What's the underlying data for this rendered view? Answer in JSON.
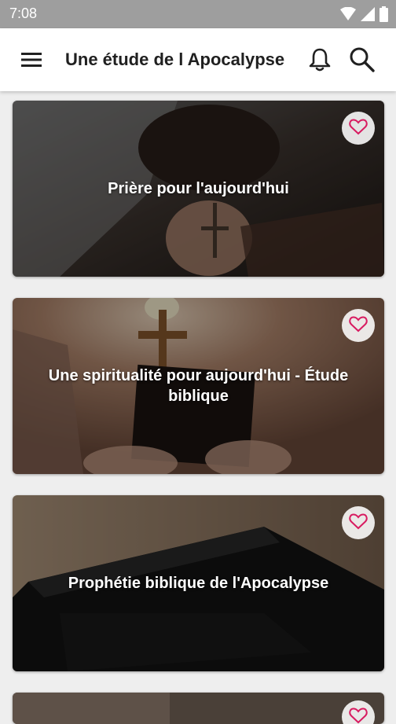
{
  "status_bar": {
    "time": "7:08"
  },
  "app_bar": {
    "title": "Une étude de l Apocalypse",
    "menu_icon": "menu-icon",
    "notifications_icon": "bell-icon",
    "search_icon": "search-icon"
  },
  "cards": [
    {
      "title": "Prière pour l'aujourd'hui",
      "favorite_icon": "heart-outline-icon"
    },
    {
      "title": "Une spiritualité pour aujourd'hui - Étude biblique",
      "favorite_icon": "heart-outline-icon"
    },
    {
      "title": "Prophétie biblique de l'Apocalypse",
      "favorite_icon": "heart-outline-icon"
    }
  ],
  "colors": {
    "status_bar": "#9e9e9e",
    "app_bar": "#ffffff",
    "background": "#eeeeee",
    "heart": "#d81b60"
  }
}
